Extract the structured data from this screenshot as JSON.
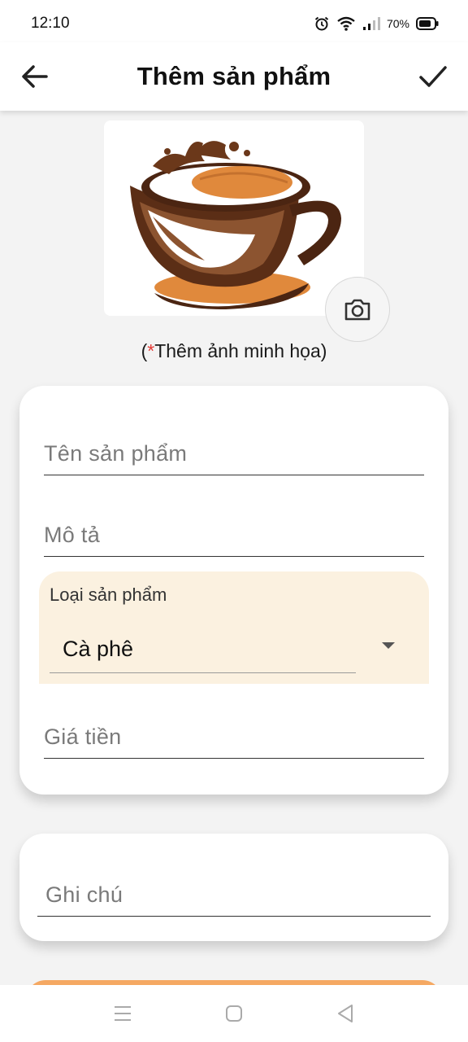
{
  "status_bar": {
    "time": "12:10",
    "battery": "70%",
    "icons": [
      "alarm-icon",
      "wifi-icon",
      "signal-icon",
      "battery-icon"
    ]
  },
  "app_bar": {
    "title": "Thêm sản phẩm",
    "back_icon": "arrow-left-icon",
    "confirm_icon": "check-icon"
  },
  "image_picker": {
    "caption_open": "(",
    "caption_required": "*",
    "caption_text": "Thêm ảnh minh họa)",
    "camera_icon": "camera-icon"
  },
  "form": {
    "name_placeholder": "Tên sản phẩm",
    "description_placeholder": "Mô tả",
    "category_label": "Loại sản phẩm",
    "category_value": "Cà phê",
    "price_placeholder": "Giá tiền",
    "note_placeholder": "Ghi chú"
  },
  "colors": {
    "accent": "#f5a862",
    "dropdown_bg": "#fbf1e0",
    "required_star": "#e53935"
  },
  "nav_bar": {
    "icons": [
      "menu-icon",
      "home-square-icon",
      "back-triangle-icon"
    ]
  }
}
